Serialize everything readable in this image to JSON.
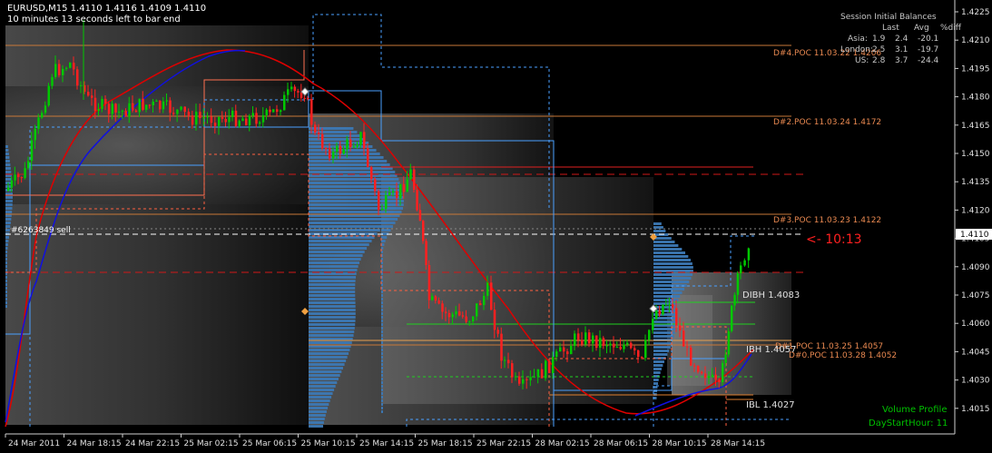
{
  "header": {
    "symbol_line": "EURUSD,M15  1.4110 1.4116 1.4109 1.4110",
    "timer_line": "10 minutes 13 seconds left to bar end"
  },
  "session_balances": {
    "title": "Session Initial Balances",
    "columns": [
      "Last",
      "Avg",
      "%diff"
    ],
    "rows": [
      {
        "session": "Asia:",
        "last": "1.9",
        "avg": "2.4",
        "diff": "-20.1"
      },
      {
        "session": "London:",
        "last": "2.5",
        "avg": "3.1",
        "diff": "-19.7"
      },
      {
        "session": "US:",
        "last": "2.8",
        "avg": "3.7",
        "diff": "-24.4"
      }
    ]
  },
  "price_axis": {
    "ticks": [
      "1.4225",
      "1.4210",
      "1.4195",
      "1.4180",
      "1.4165",
      "1.4150",
      "1.4135",
      "1.4120",
      "1.4105",
      "1.4090",
      "1.4075",
      "1.4060",
      "1.4045",
      "1.4030",
      "1.4015"
    ],
    "current_price": "1.4110"
  },
  "time_axis": {
    "labels": [
      "24 Mar 2011",
      "24 Mar 18:15",
      "24 Mar 22:15",
      "25 Mar 02:15",
      "25 Mar 06:15",
      "25 Mar 10:15",
      "25 Mar 14:15",
      "25 Mar 18:15",
      "25 Mar 22:15",
      "28 Mar 02:15",
      "28 Mar 06:15",
      "28 Mar 10:15",
      "28 Mar 14:15"
    ]
  },
  "levels": {
    "d4_poc": "D#4.POC 11.03.22 1.4206",
    "d2_poc": "D#2.POC 11.03.24 1.4172",
    "d3_poc": "D#3.POC 11.03.23 1.4122",
    "d1_poc": "D#1.POC 11.03.25 1.4057",
    "d0_poc": "D#0.POC 11.03.28 1.4052",
    "dibh": "DIBH  1.4083",
    "ibh": "IBH  1.4057",
    "ibl": "IBL  1.4027"
  },
  "order_label": "#6263849 sell",
  "countdown": "<- 10:13",
  "indicator": {
    "name": "Volume Profile",
    "setting": "DayStartHour: 11"
  },
  "colors": {
    "background": "#000000",
    "bull_candle": "#00c800",
    "bear_candle": "#ff2020",
    "profile": "#3c78b4",
    "ma_red": "#e00000",
    "ma_blue": "#0000d0",
    "level_orange": "#c87838",
    "level_text": "#e88850",
    "countdown": "#ff2020",
    "indicator_text": "#00c000"
  }
}
